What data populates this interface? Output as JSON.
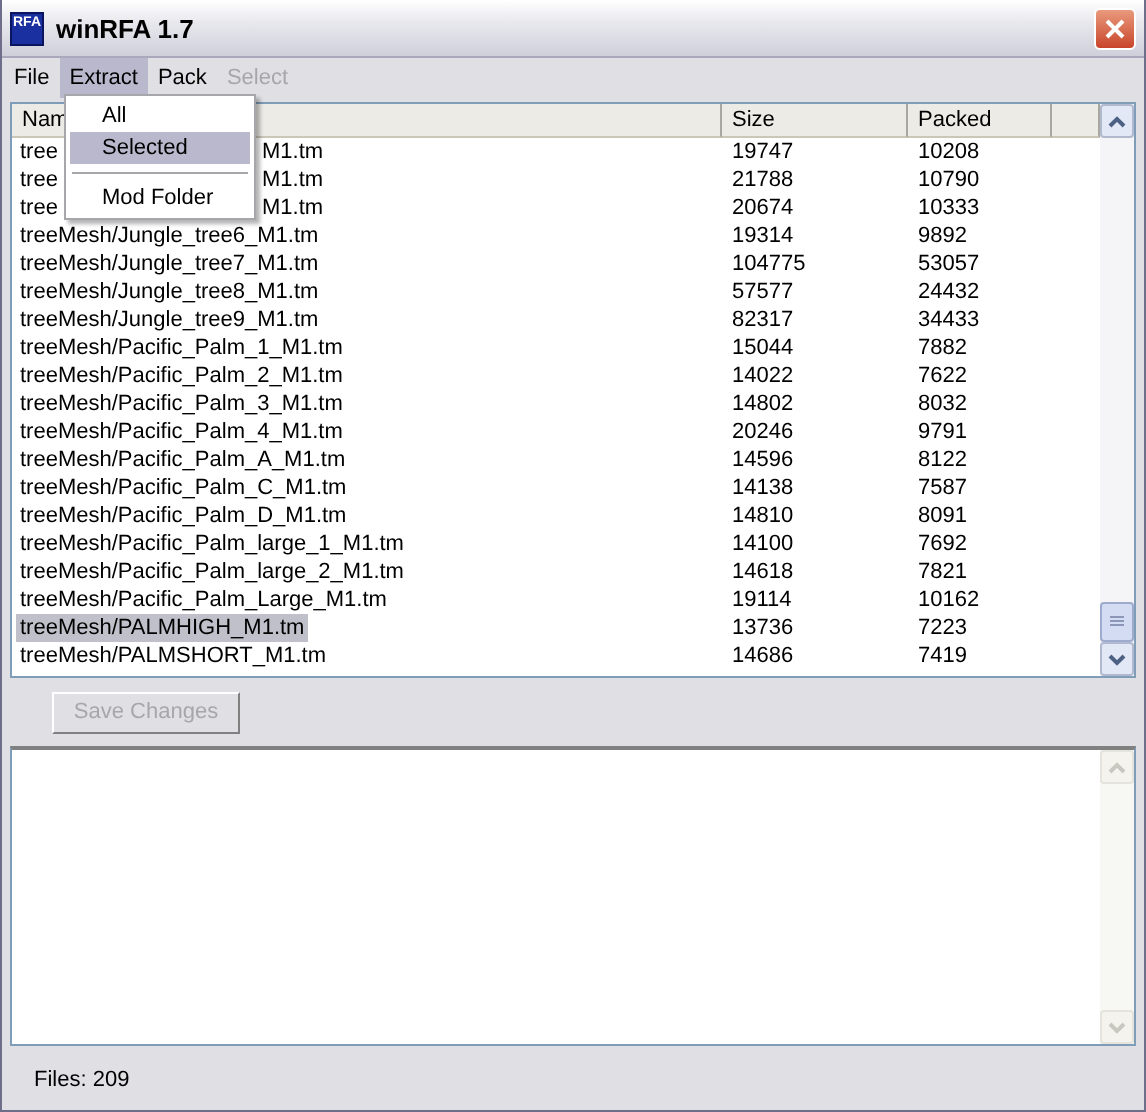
{
  "window": {
    "title": "winRFA 1.7",
    "icon_text": "RFA"
  },
  "menu_bar": [
    {
      "label": "File",
      "selected": false,
      "disabled": false
    },
    {
      "label": "Extract",
      "selected": true,
      "disabled": false
    },
    {
      "label": "Pack",
      "selected": false,
      "disabled": false
    },
    {
      "label": "Select",
      "selected": false,
      "disabled": true
    }
  ],
  "open_menu": [
    {
      "kind": "item",
      "label": "All",
      "selected": false
    },
    {
      "kind": "item",
      "label": "Selected",
      "selected": true
    },
    {
      "kind": "separator"
    },
    {
      "kind": "item",
      "label": "Mod Folder",
      "selected": false
    }
  ],
  "table": {
    "columns": [
      "Nam",
      "Size",
      "Packed"
    ],
    "rows": [
      {
        "name": "tree",
        "name_tail": "M1.tm",
        "size": "19747",
        "packed": "10208",
        "selected": false
      },
      {
        "name": "tree",
        "name_tail": "M1.tm",
        "size": "21788",
        "packed": "10790",
        "selected": false
      },
      {
        "name": "tree",
        "name_tail": "M1.tm",
        "size": "20674",
        "packed": "10333",
        "selected": false
      },
      {
        "name": "treeMesh/Jungle_tree6_M1.tm",
        "size": "19314",
        "packed": "9892",
        "selected": false
      },
      {
        "name": "treeMesh/Jungle_tree7_M1.tm",
        "size": "104775",
        "packed": "53057",
        "selected": false
      },
      {
        "name": "treeMesh/Jungle_tree8_M1.tm",
        "size": "57577",
        "packed": "24432",
        "selected": false
      },
      {
        "name": "treeMesh/Jungle_tree9_M1.tm",
        "size": "82317",
        "packed": "34433",
        "selected": false
      },
      {
        "name": "treeMesh/Pacific_Palm_1_M1.tm",
        "size": "15044",
        "packed": "7882",
        "selected": false
      },
      {
        "name": "treeMesh/Pacific_Palm_2_M1.tm",
        "size": "14022",
        "packed": "7622",
        "selected": false
      },
      {
        "name": "treeMesh/Pacific_Palm_3_M1.tm",
        "size": "14802",
        "packed": "8032",
        "selected": false
      },
      {
        "name": "treeMesh/Pacific_Palm_4_M1.tm",
        "size": "20246",
        "packed": "9791",
        "selected": false
      },
      {
        "name": "treeMesh/Pacific_Palm_A_M1.tm",
        "size": "14596",
        "packed": "8122",
        "selected": false
      },
      {
        "name": "treeMesh/Pacific_Palm_C_M1.tm",
        "size": "14138",
        "packed": "7587",
        "selected": false
      },
      {
        "name": "treeMesh/Pacific_Palm_D_M1.tm",
        "size": "14810",
        "packed": "8091",
        "selected": false
      },
      {
        "name": "treeMesh/Pacific_Palm_large_1_M1.tm",
        "size": "14100",
        "packed": "7692",
        "selected": false
      },
      {
        "name": "treeMesh/Pacific_Palm_large_2_M1.tm",
        "size": "14618",
        "packed": "7821",
        "selected": false
      },
      {
        "name": "treeMesh/Pacific_Palm_Large_M1.tm",
        "size": "19114",
        "packed": "10162",
        "selected": false
      },
      {
        "name": "treeMesh/PALMHIGH_M1.tm",
        "size": "13736",
        "packed": "7223",
        "selected": true
      },
      {
        "name": "treeMesh/PALMSHORT_M1.tm",
        "size": "14686",
        "packed": "7419",
        "selected": false
      }
    ]
  },
  "save_button": {
    "label": "Save Changes",
    "disabled": true
  },
  "status_bar": "Files: 209"
}
